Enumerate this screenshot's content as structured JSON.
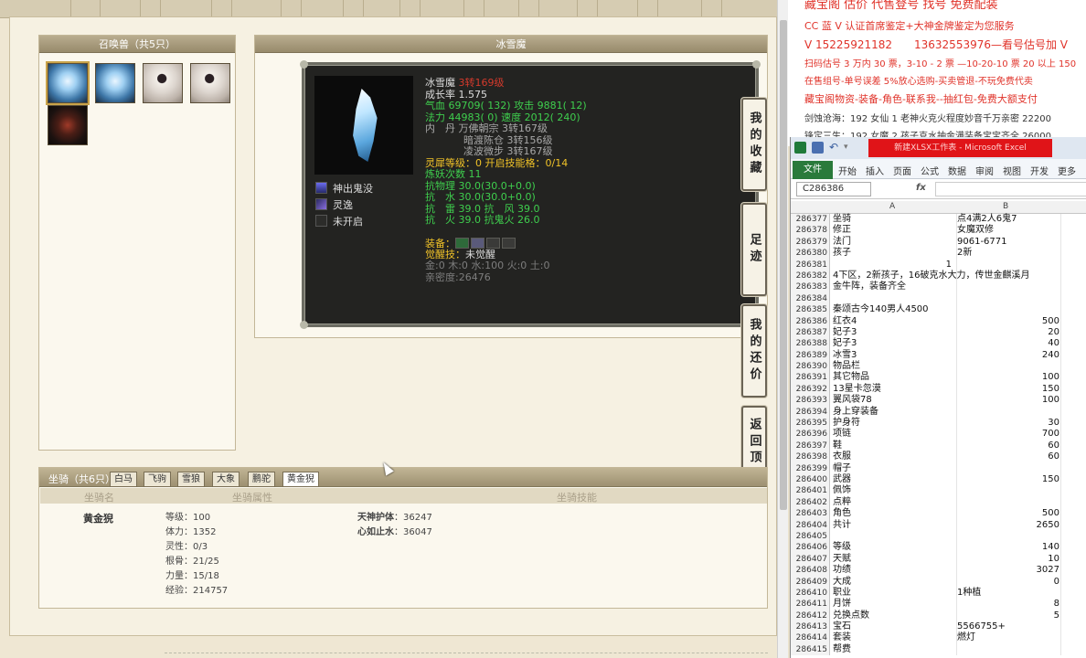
{
  "summon_panel": {
    "title": "召唤兽（共5只）",
    "pets": [
      {
        "type": "ice",
        "selected": true
      },
      {
        "type": "ice",
        "selected": false
      },
      {
        "type": "white",
        "selected": false
      },
      {
        "type": "white",
        "selected": false
      },
      {
        "type": "dark",
        "selected": false
      }
    ]
  },
  "detail_panel": {
    "title": "冰雪魔",
    "skills": [
      {
        "icon": "shadow-skill-icon",
        "label": "神出鬼没"
      },
      {
        "icon": "spirit-skill-icon",
        "label": "灵逸"
      },
      {
        "icon": "locked-skill-icon",
        "label": "未开启"
      }
    ],
    "stats": {
      "name": "冰雪魔",
      "grade": "3转169级",
      "growth": "成长率 1.575",
      "hp_label": "气血",
      "hp": "69709( 132)",
      "atk_label": "攻击",
      "atk": "9881( 12)",
      "mp_label": "法力",
      "mp": "44983( 0)",
      "spd_label": "速度",
      "spd": "2012( 240)",
      "neidan_label": "内　丹",
      "neidan": [
        {
          "name": "万佛朝宗",
          "level": "3转167级"
        },
        {
          "name": "暗渡陈仓",
          "level": "3转156级"
        },
        {
          "name": "凌波微步",
          "level": "3转167级"
        }
      ],
      "lingxi_label": "灵犀等级：",
      "lingxi": "0 开启技能格：0/14",
      "refine_label": "炼妖次数",
      "refine": "11",
      "resist_physical": "抗物理",
      "resist_physical_val": "30.0(30.0+0.0)",
      "resist_water": "抗　水",
      "resist_water_val": "30.0(30.0+0.0)",
      "resist_thunder": "抗　雷",
      "resist_thunder_val": "39.0",
      "resist_wind": "抗　风",
      "resist_wind_val": "39.0",
      "resist_fire": "抗　火",
      "resist_fire_val": "39.0",
      "resist_ghostfire": "抗鬼火",
      "resist_ghostfire_val": "26.0",
      "equip_label": "装备：",
      "awaken_label": "觉醒技：",
      "awaken": "未觉醒",
      "elements": "金:0 木:0 水:100 火:0 土:0",
      "intimacy": "亲密度:26476"
    }
  },
  "side_buttons": [
    "我的收藏",
    "足迹",
    "我的还价",
    "返回顶部"
  ],
  "mount_panel": {
    "title": "坐骑（共6只）",
    "tabs": [
      "白马",
      "飞驹",
      "雪狼",
      "大象",
      "鹏驼",
      "黄金猊"
    ],
    "active_tab": 5,
    "col_headers": [
      "坐骑名",
      "坐骑属性",
      "坐骑技能"
    ],
    "mount_name": "黄金猊",
    "attrs": [
      "等级：100",
      "体力：1352",
      "灵性：0/3",
      "根骨：21/25",
      "力量：15/18",
      "经验：214757"
    ],
    "skills": [
      {
        "name": "天神护体",
        "value": "：36247"
      },
      {
        "name": "心如止水",
        "value": "：36047"
      }
    ]
  },
  "ad_panel": {
    "lines": [
      "藏宝阁 估价 代售登号 找号 免费配装",
      "CC 蓝 V 认证首席鉴定+大神金牌鉴定为您服务",
      "V 15225921182　　13632553976—看号估号加 V",
      "扫码估号 3 万内 30 票，3-10 - 2 票 —10-20-10 票 20 以上 150",
      "在售组号-单号误差 5%放心选购-买卖管退-不玩免费代卖",
      "藏宝阁物资-装备-角色-联系我--抽红包-免费大额支付",
      "剑蚀沧海：192 女仙 1 老神火克火程度妙音千万亲密 22200",
      "锋定三生：192 女魔 2 孩子克水抽金满装备宝宝齐全 26000"
    ]
  },
  "excel": {
    "title_text": "新建XLSX工作表 - Microsoft Excel",
    "file_tab": "文件",
    "tabs": [
      "开始",
      "插入",
      "页面",
      "公式",
      "数据",
      "审阅",
      "视图",
      "开发",
      "更多"
    ],
    "name_box": "C286386",
    "fx": "fx",
    "columns": [
      "A",
      "B"
    ],
    "rows": [
      {
        "n": "286377",
        "a": "坐骑",
        "b": "点4满2人6鬼7",
        "num": false
      },
      {
        "n": "286378",
        "a": "修正",
        "b": "女魔双修",
        "num": false
      },
      {
        "n": "286379",
        "a": "法门",
        "b": "9061-6771",
        "num": false
      },
      {
        "n": "286380",
        "a": "孩子",
        "b": "2新",
        "num": false
      },
      {
        "n": "286381",
        "a": "1",
        "b": "",
        "num": false,
        "a_right": true
      },
      {
        "n": "286382",
        "a": "4下区，2新孩子，16破克水大力，传世金麒溪月",
        "b": "",
        "num": false
      },
      {
        "n": "286383",
        "a": "金牛阵，装备齐全",
        "b": "",
        "num": false
      },
      {
        "n": "286384",
        "a": "",
        "b": "",
        "num": false
      },
      {
        "n": "286385",
        "a": "秦颂古今140男人4500",
        "b": "",
        "num": false
      },
      {
        "n": "286386",
        "a": "红衣4",
        "b": "500",
        "num": true
      },
      {
        "n": "286387",
        "a": "妃子3",
        "b": "20",
        "num": true
      },
      {
        "n": "286388",
        "a": "妃子3",
        "b": "40",
        "num": true
      },
      {
        "n": "286389",
        "a": "冰雪3",
        "b": "240",
        "num": true
      },
      {
        "n": "286390",
        "a": "物品栏",
        "b": "",
        "num": false
      },
      {
        "n": "286391",
        "a": "其它物品",
        "b": "100",
        "num": true
      },
      {
        "n": "286392",
        "a": "13星卡忽漠",
        "b": "150",
        "num": true
      },
      {
        "n": "286393",
        "a": "翼风袋78",
        "b": "100",
        "num": true
      },
      {
        "n": "286394",
        "a": "身上穿装备",
        "b": "",
        "num": false
      },
      {
        "n": "286395",
        "a": "护身符",
        "b": "30",
        "num": true
      },
      {
        "n": "286396",
        "a": "项链",
        "b": "700",
        "num": true
      },
      {
        "n": "286397",
        "a": "鞋",
        "b": "60",
        "num": true
      },
      {
        "n": "286398",
        "a": "衣服",
        "b": "60",
        "num": true
      },
      {
        "n": "286399",
        "a": "帽子",
        "b": "",
        "num": false
      },
      {
        "n": "286400",
        "a": "武器",
        "b": "150",
        "num": true
      },
      {
        "n": "286401",
        "a": "佩饰",
        "b": "",
        "num": false
      },
      {
        "n": "286402",
        "a": "点粹",
        "b": "",
        "num": false
      },
      {
        "n": "286403",
        "a": "角色",
        "b": "500",
        "num": true
      },
      {
        "n": "286404",
        "a": "共计",
        "b": "2650",
        "num": true
      },
      {
        "n": "286405",
        "a": "",
        "b": "",
        "num": false
      },
      {
        "n": "286406",
        "a": "等级",
        "b": "140",
        "num": true
      },
      {
        "n": "286407",
        "a": "天赋",
        "b": "10",
        "num": true
      },
      {
        "n": "286408",
        "a": "功绩",
        "b": "3027",
        "num": true
      },
      {
        "n": "286409",
        "a": "大成",
        "b": "0",
        "num": true
      },
      {
        "n": "286410",
        "a": "职业",
        "b": "1种植",
        "num": false
      },
      {
        "n": "286411",
        "a": "月饼",
        "b": "8",
        "num": true
      },
      {
        "n": "286412",
        "a": "兑换点数",
        "b": "5",
        "num": true
      },
      {
        "n": "286413",
        "a": "宝石",
        "b": "5566755+",
        "num": false
      },
      {
        "n": "286414",
        "a": "套装",
        "b": "燃灯",
        "num": false
      },
      {
        "n": "286415",
        "a": "帮费",
        "b": "",
        "num": false
      }
    ]
  }
}
